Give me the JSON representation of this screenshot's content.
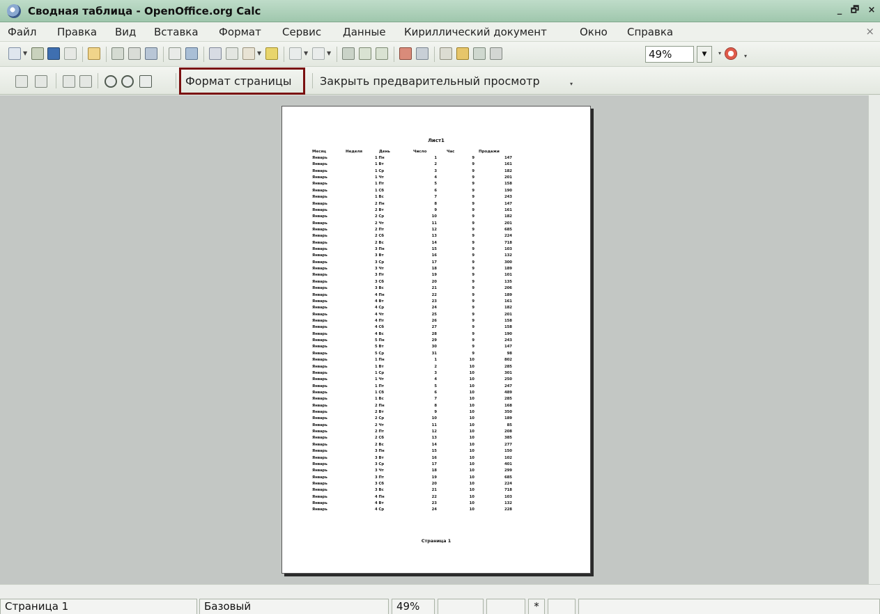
{
  "window": {
    "title": "Сводная таблица - OpenOffice.org Calc",
    "controls": [
      "_",
      "🗗",
      "×"
    ]
  },
  "menu": {
    "items": [
      "Файл",
      "Правка",
      "Вид",
      "Вставка",
      "Формат",
      "Сервис",
      "Данные",
      "Кириллический документ",
      "Окно",
      "Справка"
    ],
    "close": "×"
  },
  "toolbar": {
    "zoom_value": "49%",
    "zoom_dropdown": "▼"
  },
  "preview_toolbar": {
    "page_format": "Формат страницы",
    "close_preview": "Закрыть предварительный просмотр"
  },
  "page": {
    "sheet_title": "Лист1",
    "headers": [
      "Месяц",
      "Неделя",
      "День",
      "Число",
      "Час",
      "Продажи"
    ],
    "footer": "Страница 1",
    "rows": [
      [
        "Январь",
        "1 Пн",
        "1",
        "9",
        "147"
      ],
      [
        "Январь",
        "1 Вт",
        "2",
        "9",
        "161"
      ],
      [
        "Январь",
        "1 Ср",
        "3",
        "9",
        "182"
      ],
      [
        "Январь",
        "1 Чт",
        "4",
        "9",
        "201"
      ],
      [
        "Январь",
        "1 Пт",
        "5",
        "9",
        "158"
      ],
      [
        "Январь",
        "1 Сб",
        "6",
        "9",
        "190"
      ],
      [
        "Январь",
        "1 Вс",
        "7",
        "9",
        "243"
      ],
      [
        "Январь",
        "2 Пн",
        "8",
        "9",
        "147"
      ],
      [
        "Январь",
        "2 Вт",
        "9",
        "9",
        "161"
      ],
      [
        "Январь",
        "2 Ср",
        "10",
        "9",
        "182"
      ],
      [
        "Январь",
        "2 Чт",
        "11",
        "9",
        "201"
      ],
      [
        "Январь",
        "2 Пт",
        "12",
        "9",
        "685"
      ],
      [
        "Январь",
        "2 Сб",
        "13",
        "9",
        "224"
      ],
      [
        "Январь",
        "2 Вс",
        "14",
        "9",
        "718"
      ],
      [
        "Январь",
        "3 Пн",
        "15",
        "9",
        "103"
      ],
      [
        "Январь",
        "3 Вт",
        "16",
        "9",
        "132"
      ],
      [
        "Январь",
        "3 Ср",
        "17",
        "9",
        "300"
      ],
      [
        "Январь",
        "3 Чт",
        "18",
        "9",
        "189"
      ],
      [
        "Январь",
        "3 Пт",
        "19",
        "9",
        "101"
      ],
      [
        "Январь",
        "3 Сб",
        "20",
        "9",
        "135"
      ],
      [
        "Январь",
        "3 Вс",
        "21",
        "9",
        "206"
      ],
      [
        "Январь",
        "4 Пн",
        "22",
        "9",
        "189"
      ],
      [
        "Январь",
        "4 Вт",
        "23",
        "9",
        "161"
      ],
      [
        "Январь",
        "4 Ср",
        "24",
        "9",
        "182"
      ],
      [
        "Январь",
        "4 Чт",
        "25",
        "9",
        "201"
      ],
      [
        "Январь",
        "4 Пт",
        "26",
        "9",
        "158"
      ],
      [
        "Январь",
        "4 Сб",
        "27",
        "9",
        "158"
      ],
      [
        "Январь",
        "4 Вс",
        "28",
        "9",
        "190"
      ],
      [
        "Январь",
        "5 Пн",
        "29",
        "9",
        "243"
      ],
      [
        "Январь",
        "5 Вт",
        "30",
        "9",
        "147"
      ],
      [
        "Январь",
        "5 Ср",
        "31",
        "9",
        "98"
      ],
      [
        "Январь",
        "1 Пн",
        "1",
        "10",
        "802"
      ],
      [
        "Январь",
        "1 Вт",
        "2",
        "10",
        "285"
      ],
      [
        "Январь",
        "1 Ср",
        "3",
        "10",
        "301"
      ],
      [
        "Январь",
        "1 Чт",
        "4",
        "10",
        "250"
      ],
      [
        "Январь",
        "1 Пт",
        "5",
        "10",
        "247"
      ],
      [
        "Январь",
        "1 Сб",
        "6",
        "10",
        "489"
      ],
      [
        "Январь",
        "1 Вс",
        "7",
        "10",
        "285"
      ],
      [
        "Январь",
        "2 Пн",
        "8",
        "10",
        "168"
      ],
      [
        "Январь",
        "2 Вт",
        "9",
        "10",
        "350"
      ],
      [
        "Январь",
        "2 Ср",
        "10",
        "10",
        "189"
      ],
      [
        "Январь",
        "2 Чт",
        "11",
        "10",
        "85"
      ],
      [
        "Январь",
        "2 Пт",
        "12",
        "10",
        "208"
      ],
      [
        "Январь",
        "2 Сб",
        "13",
        "10",
        "385"
      ],
      [
        "Январь",
        "2 Вс",
        "14",
        "10",
        "277"
      ],
      [
        "Январь",
        "3 Пн",
        "15",
        "10",
        "150"
      ],
      [
        "Январь",
        "3 Вт",
        "16",
        "10",
        "102"
      ],
      [
        "Январь",
        "3 Ср",
        "17",
        "10",
        "401"
      ],
      [
        "Январь",
        "3 Чт",
        "18",
        "10",
        "299"
      ],
      [
        "Январь",
        "3 Пт",
        "19",
        "10",
        "685"
      ],
      [
        "Январь",
        "3 Сб",
        "20",
        "10",
        "224"
      ],
      [
        "Январь",
        "3 Вс",
        "21",
        "10",
        "718"
      ],
      [
        "Январь",
        "4 Пн",
        "22",
        "10",
        "103"
      ],
      [
        "Январь",
        "4 Вт",
        "23",
        "10",
        "132"
      ],
      [
        "Январь",
        "4 Ср",
        "24",
        "10",
        "228"
      ]
    ]
  },
  "status": {
    "page": "Страница 1",
    "style": "Базовый",
    "zoom": "49%",
    "modified": "*"
  },
  "colors": {
    "titlebar": "#a9cfb5",
    "highlight_border": "#7a1010",
    "workspace": "#c3c7c4"
  }
}
